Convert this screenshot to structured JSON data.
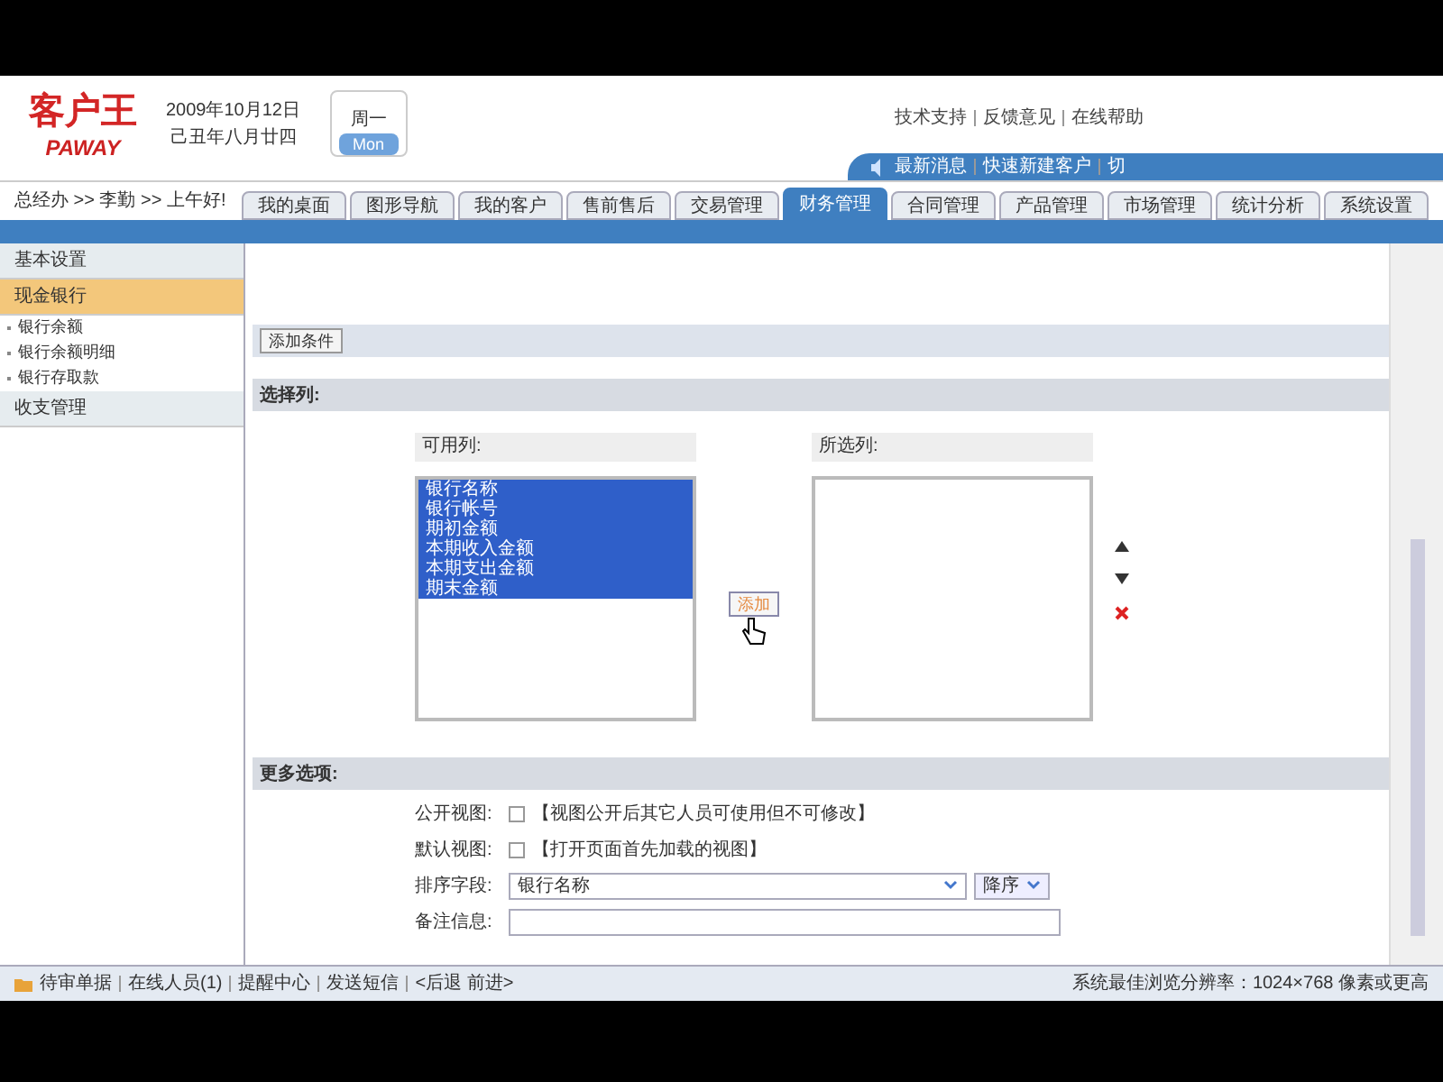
{
  "header": {
    "logo_cn": "客户王",
    "logo_en": "PAWAY",
    "date": "2009年10月12日",
    "lunar_date": "己丑年八月廿四",
    "weekday": "周一",
    "weekday_en": "Mon",
    "top_links": [
      "技术支持",
      "反馈意见",
      "在线帮助"
    ],
    "quick_links": [
      "最新消息",
      "快速新建客户",
      "切"
    ],
    "breadcrumb": "总经办 >> 李勤 >> 上午好!"
  },
  "tabs": [
    {
      "label": "我的桌面",
      "selected": false
    },
    {
      "label": "图形导航",
      "selected": false
    },
    {
      "label": "我的客户",
      "selected": false
    },
    {
      "label": "售前售后",
      "selected": false
    },
    {
      "label": "交易管理",
      "selected": false
    },
    {
      "label": "财务管理",
      "selected": true
    },
    {
      "label": "合同管理",
      "selected": false
    },
    {
      "label": "产品管理",
      "selected": false
    },
    {
      "label": "市场管理",
      "selected": false
    },
    {
      "label": "统计分析",
      "selected": false
    },
    {
      "label": "系统设置",
      "selected": false
    }
  ],
  "sidebar": {
    "items": [
      {
        "label": "基本设置",
        "selected": false
      },
      {
        "label": "现金银行",
        "selected": true,
        "children": [
          {
            "label": "银行余额"
          },
          {
            "label": "银行余额明细"
          },
          {
            "label": "银行存取款"
          }
        ]
      },
      {
        "label": "收支管理",
        "selected": false
      }
    ]
  },
  "add_condition_button": "添加条件",
  "choose_columns": {
    "title": "选择列:",
    "available_label": "可用列:",
    "selected_label": "所选列:",
    "add_button": "添加",
    "available": [
      {
        "label": "银行名称",
        "selected": true
      },
      {
        "label": "银行帐号",
        "selected": true
      },
      {
        "label": "期初金额",
        "selected": true
      },
      {
        "label": "本期收入金额",
        "selected": true
      },
      {
        "label": "本期支出金额",
        "selected": true
      },
      {
        "label": "期末金额",
        "selected": true
      }
    ]
  },
  "more_options": {
    "title": "更多选项:",
    "rows": [
      {
        "kind": "checkbox",
        "label": "公开视图:",
        "checked": false,
        "note": "【视图公开后其它人员可使用但不可修改】"
      },
      {
        "kind": "checkbox",
        "label": "默认视图:",
        "checked": false,
        "note": "【打开页面首先加载的视图】"
      },
      {
        "kind": "sort",
        "label": "排序字段:",
        "value": "银行名称",
        "order": "降序"
      },
      {
        "kind": "text",
        "label": "备注信息:",
        "value": ""
      }
    ]
  },
  "status_bar": {
    "items": [
      "待审单据",
      "在线人员(1)",
      "提醒中心",
      "发送短信",
      "<后退 前进>"
    ],
    "resolution_note": "系统最佳浏览分辨率：1024×768 像素或更高"
  }
}
